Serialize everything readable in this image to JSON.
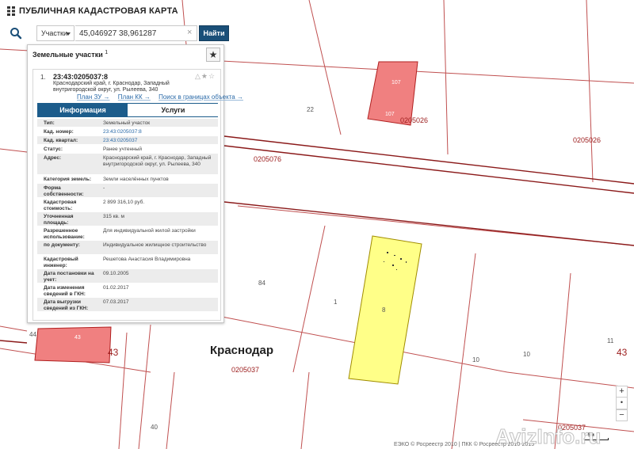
{
  "app": {
    "title": "ПУБЛИЧНАЯ КАДАСТРОВАЯ КАРТА",
    "logo_icon": "cadastre-logo-icon"
  },
  "search": {
    "icon": "search-icon",
    "type_selected": "Участки",
    "query": "45,046927 38,961287",
    "clear_glyph": "×",
    "button_label": "Найти"
  },
  "panel": {
    "title": "Земельные участки",
    "count": "1",
    "star_glyph": "★",
    "result": {
      "number": "1.",
      "id": "23:43:0205037:8",
      "icons": "△★☆",
      "address": "Краснодарский край, г. Краснодар, Западный внутригородской округ, ул. Рылеева, 340",
      "links": [
        "План ЗУ →",
        "План КК →",
        "Поиск в границах объекта →"
      ]
    },
    "tabs": [
      "Информация",
      "Услуги"
    ],
    "rows": [
      {
        "k": "Тип:",
        "v": "Земельный участок"
      },
      {
        "k": "Кад. номер:",
        "v": "23:43:0205037:8"
      },
      {
        "k": "Кад. квартал:",
        "v": "23:43:0205037"
      },
      {
        "k": "Статус:",
        "v": "Ранее учтенный"
      },
      {
        "k": "Адрес:",
        "v": "Краснодарский край, г. Краснодар, Западный внутригородской округ, ул. Рылеева, 340"
      },
      {
        "k": "Категория земель:",
        "v": "Земли населённых пунктов"
      },
      {
        "k": "Форма собственности:",
        "v": "-"
      },
      {
        "k": "Кадастровая стоимость:",
        "v": "2 899 316,10 руб."
      },
      {
        "k": "Уточненная площадь:",
        "v": "315 кв. м"
      },
      {
        "k": "Разрешенное использование:",
        "v": "Для индивидуальной жилой застройки"
      },
      {
        "k": "по документу:",
        "v": "Индивидуальное жилищное строительство"
      },
      {
        "k": "Кадастровый инженер:",
        "v": "Решетова Анастасия Владимировна"
      },
      {
        "k": "Дата постановки на учет:",
        "v": "09.10.2005"
      },
      {
        "k": "Дата изменения сведений в ГКН:",
        "v": "01.02.2017"
      },
      {
        "k": "Дата выгрузки сведений из ГКН:",
        "v": "07.03.2017"
      }
    ]
  },
  "map": {
    "city_label": "Краснодар",
    "labels": {
      "q1": "0205026",
      "q2": "0205026",
      "q3": "0205076",
      "q4": "0205037",
      "q5": "0205037",
      "n22": "22",
      "n84": "84",
      "n1": "1",
      "n8": "8",
      "n10a": "10",
      "n10b": "10",
      "n11": "11",
      "n40": "40",
      "n44": "44",
      "n43a": "43",
      "n43b": "43",
      "h1": "107",
      "h2": "107",
      "h3": "43"
    },
    "colors": {
      "highlight_fill": "#ffff88",
      "building_fill": "#f08080",
      "parcel_line": "#c05050",
      "road_line": "#8b1a1a"
    },
    "zoom_in": "+",
    "zoom_mid": "•",
    "zoom_out": "−",
    "scale": "5м",
    "copyright": "ЕЭКО © Росреестр 2010 | ПКК © Росреестр 2010-2015",
    "watermark": "AvizInfo.ru"
  }
}
